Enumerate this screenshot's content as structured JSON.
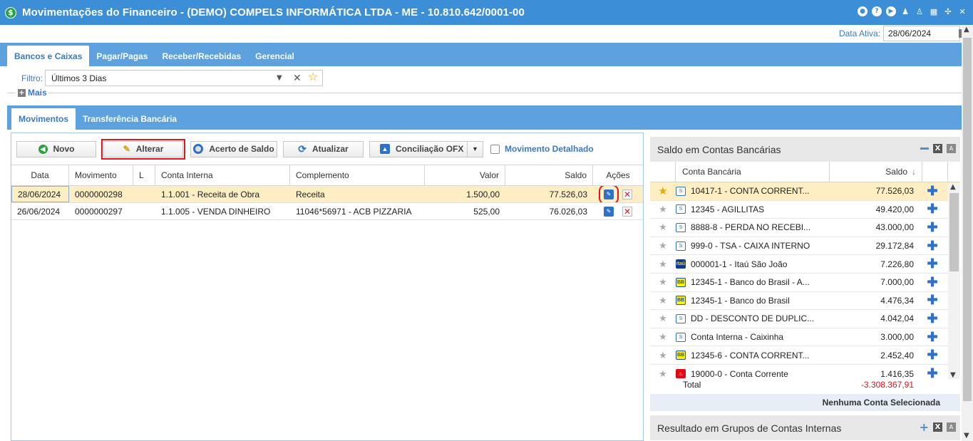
{
  "window": {
    "title": "Movimentações do Financeiro - (DEMO) COMPELS INFORMÁTICA LTDA - ME - 10.810.642/0001-00",
    "logo": "$"
  },
  "date": {
    "label": "Data Ativa:",
    "value": "28/06/2024"
  },
  "main_tabs": [
    {
      "label": "Bancos e Caixas",
      "active": true
    },
    {
      "label": "Pagar/Pagas",
      "active": false
    },
    {
      "label": "Receber/Recebidas",
      "active": false
    },
    {
      "label": "Gerencial",
      "active": false
    }
  ],
  "filter": {
    "label": "Filtro:",
    "value": "Últimos 3 Dias",
    "more_label": "Mais"
  },
  "sub_tabs": [
    {
      "label": "Movimentos",
      "active": true
    },
    {
      "label": "Transferência Bancária",
      "active": false
    }
  ],
  "toolbar": {
    "novo": "Novo",
    "alterar": "Alterar",
    "acerto": "Acerto de Saldo",
    "atualizar": "Atualizar",
    "conciliacao": "Conciliação OFX",
    "detalhado": "Movimento Detalhado"
  },
  "grid": {
    "headers": [
      "Data",
      "Movimento",
      "L",
      "Conta Interna",
      "Complemento",
      "Valor",
      "Saldo",
      "Ações"
    ],
    "rows": [
      {
        "data": "28/06/2024",
        "movimento": "0000000298",
        "l": "",
        "conta": "1.1.001 - Receita de Obra",
        "complemento": "Receita",
        "valor": "1.500,00",
        "saldo": "77.526,03"
      },
      {
        "data": "26/06/2024",
        "movimento": "0000000297",
        "l": "",
        "conta": "1.1.005 - VENDA DINHEIRO",
        "complemento": "11046*56971 - ACB PIZZARIA",
        "valor": "525,00",
        "saldo": "76.026,03"
      }
    ]
  },
  "saldo_panel": {
    "title": "Saldo em Contas Bancárias",
    "col_conta": "Conta Bancária",
    "col_saldo": "Saldo",
    "accounts": [
      {
        "name": "10417-1 - CONTA CORRENT...",
        "saldo": "77.526,03",
        "icon": "generic-bank-icon",
        "fav": true
      },
      {
        "name": "12345 - AGILLITAS",
        "saldo": "49.420,00",
        "icon": "generic-bank-icon",
        "fav": false
      },
      {
        "name": "8888-8 - PERDA NO RECEBI...",
        "saldo": "43.000,00",
        "icon": "generic-bank-icon",
        "fav": false
      },
      {
        "name": "999-0 - TSA - CAIXA INTERNO",
        "saldo": "29.172,84",
        "icon": "generic-bank-icon",
        "fav": false
      },
      {
        "name": "000001-1 - Itaú São João",
        "saldo": "7.226,80",
        "icon": "itau-icon",
        "fav": false
      },
      {
        "name": "12345-1 - Banco do Brasil - A...",
        "saldo": "7.000,00",
        "icon": "bb-icon",
        "fav": false
      },
      {
        "name": "12345-1 - Banco do Brasil",
        "saldo": "4.476,34",
        "icon": "bb-icon",
        "fav": false
      },
      {
        "name": "DD - DESCONTO DE DUPLIC...",
        "saldo": "4.042,04",
        "icon": "generic-bank-icon",
        "fav": false
      },
      {
        "name": "Conta Interna - Caixinha",
        "saldo": "3.000,00",
        "icon": "generic-bank-icon",
        "fav": false
      },
      {
        "name": "12345-6 - CONTA CORRENT...",
        "saldo": "2.452,40",
        "icon": "bb-icon",
        "fav": false
      },
      {
        "name": "19000-0 - Conta Corrente",
        "saldo": "1.416,35",
        "icon": "santander-icon",
        "fav": false
      }
    ],
    "total_label": "Total",
    "total_value": "-3.308.367,91",
    "status": "Nenhuma Conta Selecionada"
  },
  "grupos_panel": {
    "title": "Resultado em Grupos de Contas Internas"
  },
  "colors": {
    "accent": "#3c8ed6",
    "tab_bar": "#5da1de",
    "link": "#3979c7",
    "selected_row": "#fdefc3",
    "highlight": "#e8141b",
    "negative": "#d0171e"
  }
}
